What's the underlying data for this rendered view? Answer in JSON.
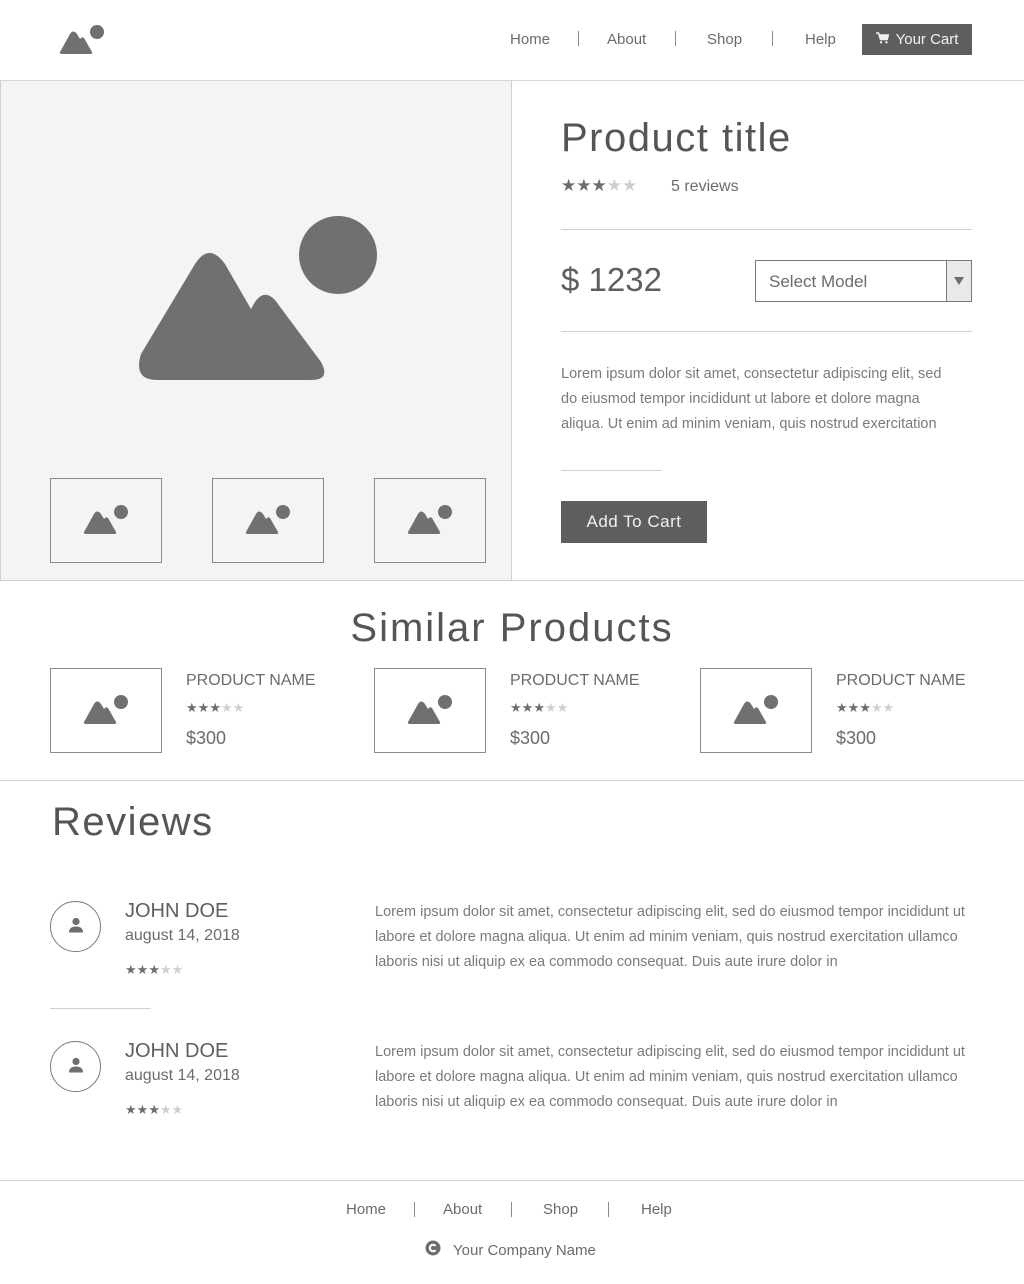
{
  "nav": {
    "home": "Home",
    "about": "About",
    "shop": "Shop",
    "help": "Help",
    "cart": "Your Cart"
  },
  "product": {
    "title": "Product title",
    "rating": 3,
    "rating_max": 5,
    "reviews": "5 reviews",
    "price": "$ 1232",
    "select_model": "Select Model",
    "description": "Lorem ipsum dolor sit amet, consectetur adipiscing elit, sed do eiusmod tempor incididunt ut labore et dolore magna aliqua. Ut enim ad minim veniam, quis nostrud exercitation",
    "add_to_cart": "Add To Cart"
  },
  "similar": {
    "heading": "Similar Products",
    "items": [
      {
        "name": "PRODUCT NAME",
        "rating": 3,
        "price": "$300"
      },
      {
        "name": "PRODUCT NAME",
        "rating": 3,
        "price": "$300"
      },
      {
        "name": "PRODUCT NAME",
        "rating": 3,
        "price": "$300"
      }
    ]
  },
  "reviews": {
    "heading": "Reviews",
    "items": [
      {
        "name": "JOHN DOE",
        "date": "august 14, 2018",
        "rating": 3,
        "text": "Lorem ipsum dolor sit amet, consectetur adipiscing elit, sed do eiusmod tempor incididunt ut labore et dolore magna aliqua. Ut enim ad minim veniam, quis nostrud exercitation ullamco laboris nisi ut aliquip ex ea commodo consequat. Duis aute irure dolor in"
      },
      {
        "name": "JOHN DOE",
        "date": "august 14, 2018",
        "rating": 3,
        "text": "Lorem ipsum dolor sit amet, consectetur adipiscing elit, sed do eiusmod tempor incididunt ut labore et dolore magna aliqua. Ut enim ad minim veniam, quis nostrud exercitation ullamco laboris nisi ut aliquip ex ea commodo consequat. Duis aute irure dolor in"
      }
    ]
  },
  "footer": {
    "home": "Home",
    "about": "About",
    "shop": "Shop",
    "help": "Help",
    "company": "Your Company Name"
  },
  "icons": {
    "logo": "image-placeholder-icon",
    "cart": "shopping-cart-icon",
    "dropdown": "triangle-down-icon",
    "avatar": "user-icon",
    "copyright": "copyright-icon"
  },
  "colors": {
    "accent": "#5e5e5e",
    "background": "#ffffff",
    "gallery_bg": "#f4f4f4"
  }
}
